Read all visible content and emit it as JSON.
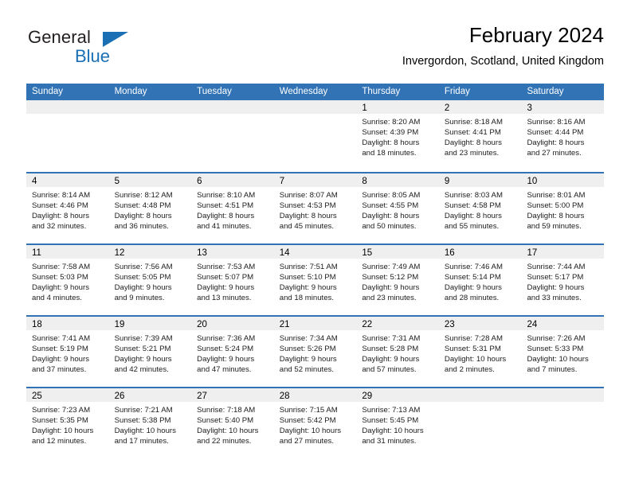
{
  "brand": {
    "name_part1": "General",
    "name_part2": "Blue",
    "triangle_color": "#1a6fb5",
    "text_color": "#231f20"
  },
  "header": {
    "title": "February 2024",
    "subtitle": "Invergordon, Scotland, United Kingdom"
  },
  "theme": {
    "header_blue": "#3173b5",
    "band_gray": "#efeff0",
    "text_black": "#000000"
  },
  "weekday_headers": [
    "Sunday",
    "Monday",
    "Tuesday",
    "Wednesday",
    "Thursday",
    "Friday",
    "Saturday"
  ],
  "weeks": [
    [
      {
        "day": "",
        "lines": []
      },
      {
        "day": "",
        "lines": []
      },
      {
        "day": "",
        "lines": []
      },
      {
        "day": "",
        "lines": []
      },
      {
        "day": "1",
        "lines": [
          "Sunrise: 8:20 AM",
          "Sunset: 4:39 PM",
          "Daylight: 8 hours",
          "and 18 minutes."
        ]
      },
      {
        "day": "2",
        "lines": [
          "Sunrise: 8:18 AM",
          "Sunset: 4:41 PM",
          "Daylight: 8 hours",
          "and 23 minutes."
        ]
      },
      {
        "day": "3",
        "lines": [
          "Sunrise: 8:16 AM",
          "Sunset: 4:44 PM",
          "Daylight: 8 hours",
          "and 27 minutes."
        ]
      }
    ],
    [
      {
        "day": "4",
        "lines": [
          "Sunrise: 8:14 AM",
          "Sunset: 4:46 PM",
          "Daylight: 8 hours",
          "and 32 minutes."
        ]
      },
      {
        "day": "5",
        "lines": [
          "Sunrise: 8:12 AM",
          "Sunset: 4:48 PM",
          "Daylight: 8 hours",
          "and 36 minutes."
        ]
      },
      {
        "day": "6",
        "lines": [
          "Sunrise: 8:10 AM",
          "Sunset: 4:51 PM",
          "Daylight: 8 hours",
          "and 41 minutes."
        ]
      },
      {
        "day": "7",
        "lines": [
          "Sunrise: 8:07 AM",
          "Sunset: 4:53 PM",
          "Daylight: 8 hours",
          "and 45 minutes."
        ]
      },
      {
        "day": "8",
        "lines": [
          "Sunrise: 8:05 AM",
          "Sunset: 4:55 PM",
          "Daylight: 8 hours",
          "and 50 minutes."
        ]
      },
      {
        "day": "9",
        "lines": [
          "Sunrise: 8:03 AM",
          "Sunset: 4:58 PM",
          "Daylight: 8 hours",
          "and 55 minutes."
        ]
      },
      {
        "day": "10",
        "lines": [
          "Sunrise: 8:01 AM",
          "Sunset: 5:00 PM",
          "Daylight: 8 hours",
          "and 59 minutes."
        ]
      }
    ],
    [
      {
        "day": "11",
        "lines": [
          "Sunrise: 7:58 AM",
          "Sunset: 5:03 PM",
          "Daylight: 9 hours",
          "and 4 minutes."
        ]
      },
      {
        "day": "12",
        "lines": [
          "Sunrise: 7:56 AM",
          "Sunset: 5:05 PM",
          "Daylight: 9 hours",
          "and 9 minutes."
        ]
      },
      {
        "day": "13",
        "lines": [
          "Sunrise: 7:53 AM",
          "Sunset: 5:07 PM",
          "Daylight: 9 hours",
          "and 13 minutes."
        ]
      },
      {
        "day": "14",
        "lines": [
          "Sunrise: 7:51 AM",
          "Sunset: 5:10 PM",
          "Daylight: 9 hours",
          "and 18 minutes."
        ]
      },
      {
        "day": "15",
        "lines": [
          "Sunrise: 7:49 AM",
          "Sunset: 5:12 PM",
          "Daylight: 9 hours",
          "and 23 minutes."
        ]
      },
      {
        "day": "16",
        "lines": [
          "Sunrise: 7:46 AM",
          "Sunset: 5:14 PM",
          "Daylight: 9 hours",
          "and 28 minutes."
        ]
      },
      {
        "day": "17",
        "lines": [
          "Sunrise: 7:44 AM",
          "Sunset: 5:17 PM",
          "Daylight: 9 hours",
          "and 33 minutes."
        ]
      }
    ],
    [
      {
        "day": "18",
        "lines": [
          "Sunrise: 7:41 AM",
          "Sunset: 5:19 PM",
          "Daylight: 9 hours",
          "and 37 minutes."
        ]
      },
      {
        "day": "19",
        "lines": [
          "Sunrise: 7:39 AM",
          "Sunset: 5:21 PM",
          "Daylight: 9 hours",
          "and 42 minutes."
        ]
      },
      {
        "day": "20",
        "lines": [
          "Sunrise: 7:36 AM",
          "Sunset: 5:24 PM",
          "Daylight: 9 hours",
          "and 47 minutes."
        ]
      },
      {
        "day": "21",
        "lines": [
          "Sunrise: 7:34 AM",
          "Sunset: 5:26 PM",
          "Daylight: 9 hours",
          "and 52 minutes."
        ]
      },
      {
        "day": "22",
        "lines": [
          "Sunrise: 7:31 AM",
          "Sunset: 5:28 PM",
          "Daylight: 9 hours",
          "and 57 minutes."
        ]
      },
      {
        "day": "23",
        "lines": [
          "Sunrise: 7:28 AM",
          "Sunset: 5:31 PM",
          "Daylight: 10 hours",
          "and 2 minutes."
        ]
      },
      {
        "day": "24",
        "lines": [
          "Sunrise: 7:26 AM",
          "Sunset: 5:33 PM",
          "Daylight: 10 hours",
          "and 7 minutes."
        ]
      }
    ],
    [
      {
        "day": "25",
        "lines": [
          "Sunrise: 7:23 AM",
          "Sunset: 5:35 PM",
          "Daylight: 10 hours",
          "and 12 minutes."
        ]
      },
      {
        "day": "26",
        "lines": [
          "Sunrise: 7:21 AM",
          "Sunset: 5:38 PM",
          "Daylight: 10 hours",
          "and 17 minutes."
        ]
      },
      {
        "day": "27",
        "lines": [
          "Sunrise: 7:18 AM",
          "Sunset: 5:40 PM",
          "Daylight: 10 hours",
          "and 22 minutes."
        ]
      },
      {
        "day": "28",
        "lines": [
          "Sunrise: 7:15 AM",
          "Sunset: 5:42 PM",
          "Daylight: 10 hours",
          "and 27 minutes."
        ]
      },
      {
        "day": "29",
        "lines": [
          "Sunrise: 7:13 AM",
          "Sunset: 5:45 PM",
          "Daylight: 10 hours",
          "and 31 minutes."
        ]
      },
      {
        "day": "",
        "lines": []
      },
      {
        "day": "",
        "lines": []
      }
    ]
  ]
}
